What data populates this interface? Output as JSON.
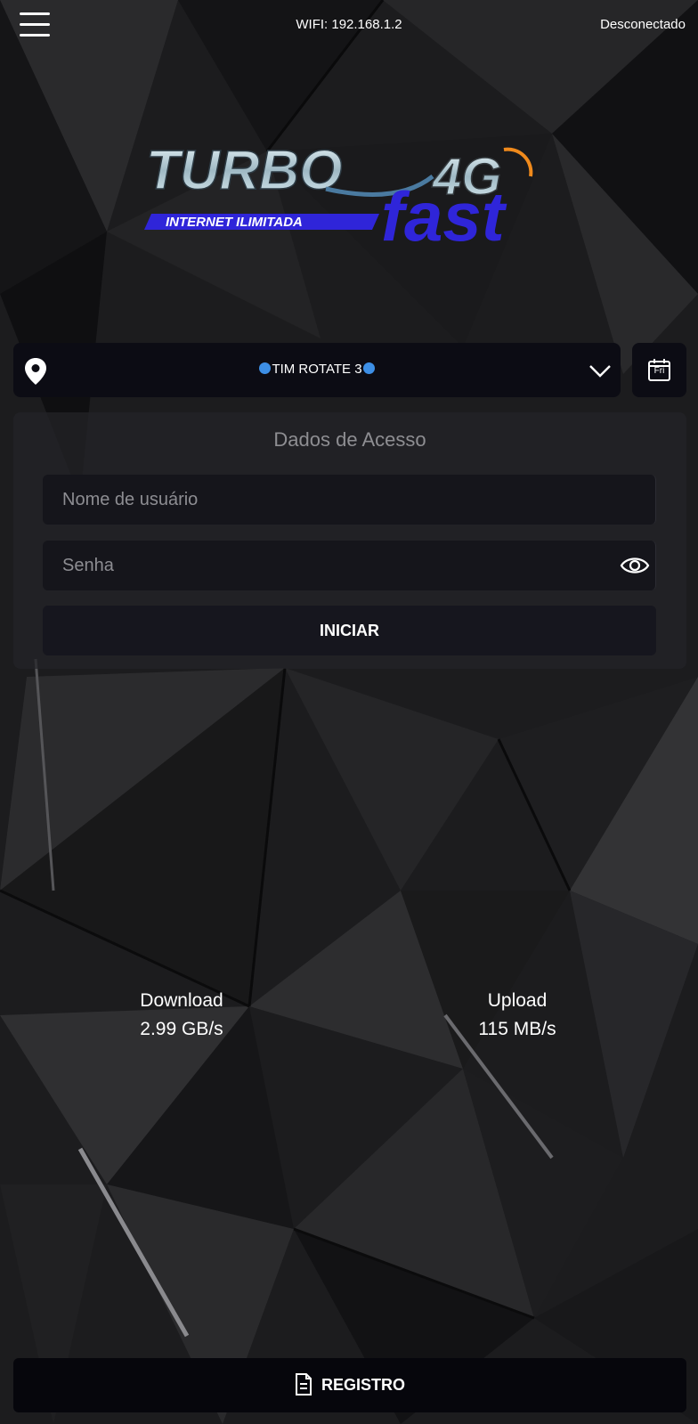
{
  "topbar": {
    "menu_icon": "hamburger-menu-icon",
    "wifi": "WIFI: 192.168.1.2",
    "status": "Desconectado"
  },
  "logo": {
    "word_turbo": "TURBO",
    "word_4g": "4G",
    "word_fast": "fast",
    "tagline": "INTERNET ILIMITADA",
    "colors": {
      "silver": "#cfe3ec",
      "blue": "#2f25d9",
      "orange": "#f08a1c"
    }
  },
  "server": {
    "icon": "location-pin-icon",
    "selected": "TIM ROTATE 3",
    "marker_color": "#3d8fe6",
    "dropdown_icon": "chevron-down-icon"
  },
  "calendar": {
    "icon": "calendar-icon",
    "day": "Fri"
  },
  "access": {
    "title": "Dados de Acesso",
    "username_placeholder": "Nome de usuário",
    "password_placeholder": "Senha",
    "eye_icon": "eye-icon",
    "start_label": "INICIAR"
  },
  "stats": {
    "download_label": "Download",
    "download_value": "2.99 GB/s",
    "upload_label": "Upload",
    "upload_value": "115 MB/s"
  },
  "register": {
    "icon": "document-icon",
    "label": "REGISTRO"
  }
}
